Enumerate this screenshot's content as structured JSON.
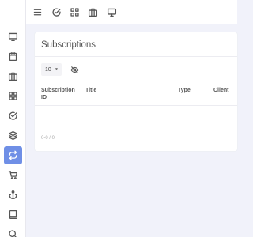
{
  "sidebar": {
    "items": [
      {
        "icon": "monitor-icon",
        "active": false
      },
      {
        "icon": "calendar-icon",
        "active": false
      },
      {
        "icon": "briefcase-icon",
        "active": false
      },
      {
        "icon": "grid-icon",
        "active": false
      },
      {
        "icon": "check-circle-icon",
        "active": false
      },
      {
        "icon": "layers-icon",
        "active": false
      },
      {
        "icon": "repeat-icon",
        "active": true
      },
      {
        "icon": "cart-icon",
        "active": false
      },
      {
        "icon": "anchor-icon",
        "active": false
      },
      {
        "icon": "book-icon",
        "active": false
      },
      {
        "icon": "search-icon",
        "active": false
      }
    ],
    "active_color": "#6f8fe6"
  },
  "topbar": {
    "icons": [
      "menu-icon",
      "check-circle-icon",
      "grid-icon",
      "briefcase-icon",
      "monitor-icon"
    ]
  },
  "card": {
    "title": "Subscriptions",
    "per_page": "10",
    "columns": [
      "Subscription ID",
      "Title",
      "Type",
      "Client"
    ],
    "pagination": "0-0 / 0"
  }
}
